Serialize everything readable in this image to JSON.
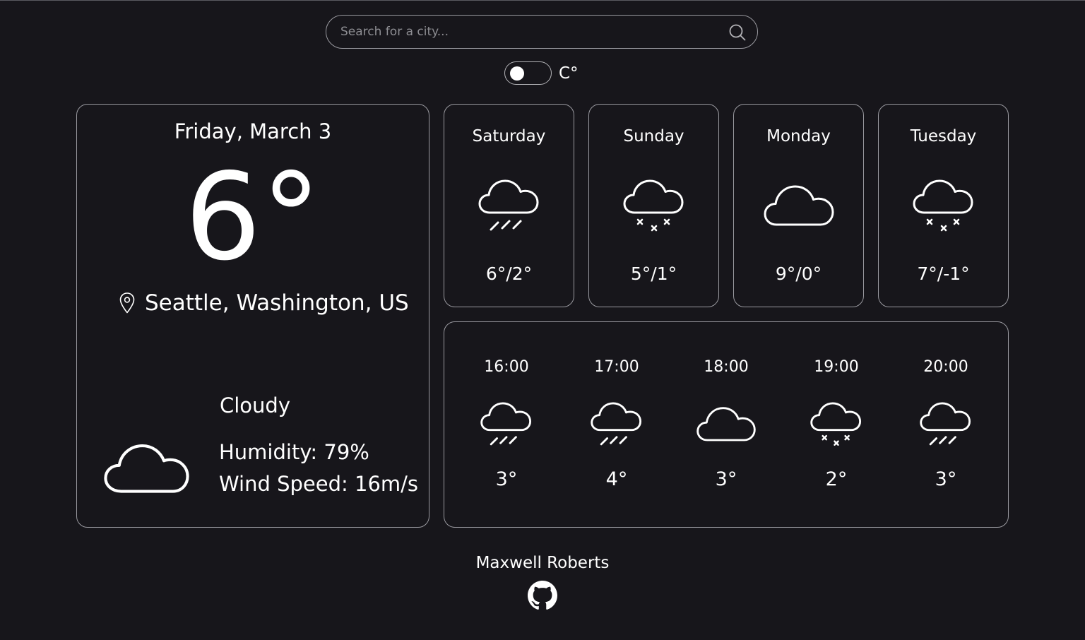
{
  "search": {
    "placeholder": "Search for a city..."
  },
  "unit_toggle": {
    "label": "C°",
    "is_fahrenheit": false
  },
  "current": {
    "date": "Friday, March 3",
    "temperature": "6°",
    "location": "Seattle, Washington, US",
    "condition": "Cloudy",
    "condition_icon": "cloud-icon",
    "humidity": "Humidity: 79%",
    "wind_speed": "Wind Speed: 16m/s"
  },
  "daily": [
    {
      "day": "Saturday",
      "icon": "cloud-rain-icon",
      "temps": "6°/2°"
    },
    {
      "day": "Sunday",
      "icon": "cloud-snow-icon",
      "temps": "5°/1°"
    },
    {
      "day": "Monday",
      "icon": "cloud-icon",
      "temps": "9°/0°"
    },
    {
      "day": "Tuesday",
      "icon": "cloud-snow-icon",
      "temps": "7°/-1°"
    }
  ],
  "hourly": [
    {
      "time": "16:00",
      "icon": "cloud-rain-icon",
      "temp": "3°"
    },
    {
      "time": "17:00",
      "icon": "cloud-rain-icon",
      "temp": "4°"
    },
    {
      "time": "18:00",
      "icon": "cloud-icon",
      "temp": "3°"
    },
    {
      "time": "19:00",
      "icon": "cloud-snow-icon",
      "temp": "2°"
    },
    {
      "time": "20:00",
      "icon": "cloud-rain-icon",
      "temp": "3°"
    }
  ],
  "footer": {
    "author": "Maxwell Roberts",
    "link_icon": "github-icon"
  },
  "colors": {
    "background": "#17161b",
    "border": "#9a9aa0",
    "text": "#ffffff",
    "placeholder": "#8d8d92"
  }
}
